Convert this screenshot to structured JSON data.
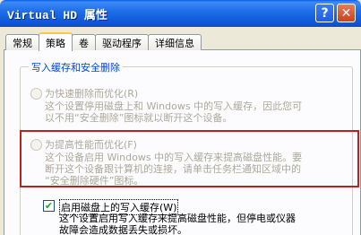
{
  "window": {
    "title": "Virtual HD 属性",
    "help_label": "?",
    "close_label": "✕"
  },
  "tabs": [
    {
      "label": "常规"
    },
    {
      "label": "策略"
    },
    {
      "label": "卷"
    },
    {
      "label": "驱动程序"
    },
    {
      "label": "详细信息"
    }
  ],
  "group": {
    "title": "写入缓存和安全删除"
  },
  "options": {
    "quick_removal": {
      "label": "为快速删除而优化(R)",
      "desc_line1": "这个设置停用磁盘上和 Windows 中的写入缓存，因此您可",
      "desc_line2": "以不用“安全删除”图标就以断开这个设备。"
    },
    "performance": {
      "label": "为提高性能而优化(F)",
      "desc_line1": "这个设备启用 Windows 中的写入缓存来提高磁盘性能。要",
      "desc_line2": "断开这个设备跟计算机的连接，请单击任务栏通知区域中的",
      "desc_line3": "“安全删除硬件”图标。"
    },
    "write_cache": {
      "label": "启用磁盘上的写入缓存(W)",
      "checked": true,
      "desc_line1": "这个设置启用写入缓存来提高磁盘性能，但停电或仪器",
      "desc_line2": "故障会造成数据丢失或损坏。"
    }
  }
}
